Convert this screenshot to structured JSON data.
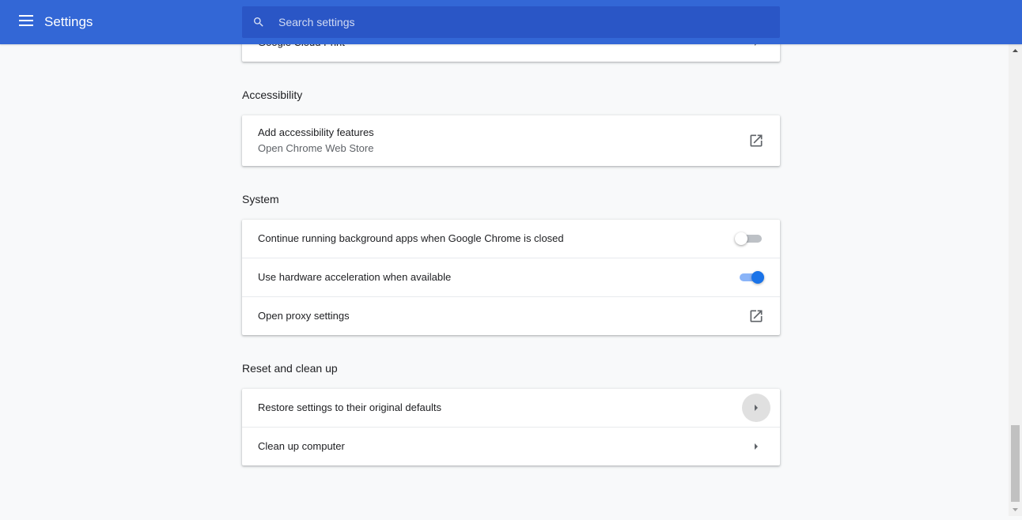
{
  "toolbar": {
    "title": "Settings",
    "search_placeholder": "Search settings"
  },
  "top_card": {
    "label": "Google Cloud Print"
  },
  "accessibility": {
    "title": "Accessibility",
    "row": {
      "label": "Add accessibility features",
      "sublabel": "Open Chrome Web Store"
    }
  },
  "system": {
    "title": "System",
    "rows": [
      {
        "label": "Continue running background apps when Google Chrome is closed",
        "state": "off"
      },
      {
        "label": "Use hardware acceleration when available",
        "state": "on"
      },
      {
        "label": "Open proxy settings"
      }
    ]
  },
  "reset": {
    "title": "Reset and clean up",
    "rows": [
      {
        "label": "Restore settings to their original defaults"
      },
      {
        "label": "Clean up computer"
      }
    ]
  },
  "icons": {
    "menu": "hamburger-menu-icon",
    "search": "search-icon",
    "external": "external-link-icon",
    "arrow": "arrow-right-icon"
  },
  "colors": {
    "toolbar": "#3367d6",
    "search_bg": "#2a56c6",
    "toggle_on": "#1a73e8",
    "toggle_track_on": "#8ab4f8",
    "background": "#f8f9fa"
  }
}
